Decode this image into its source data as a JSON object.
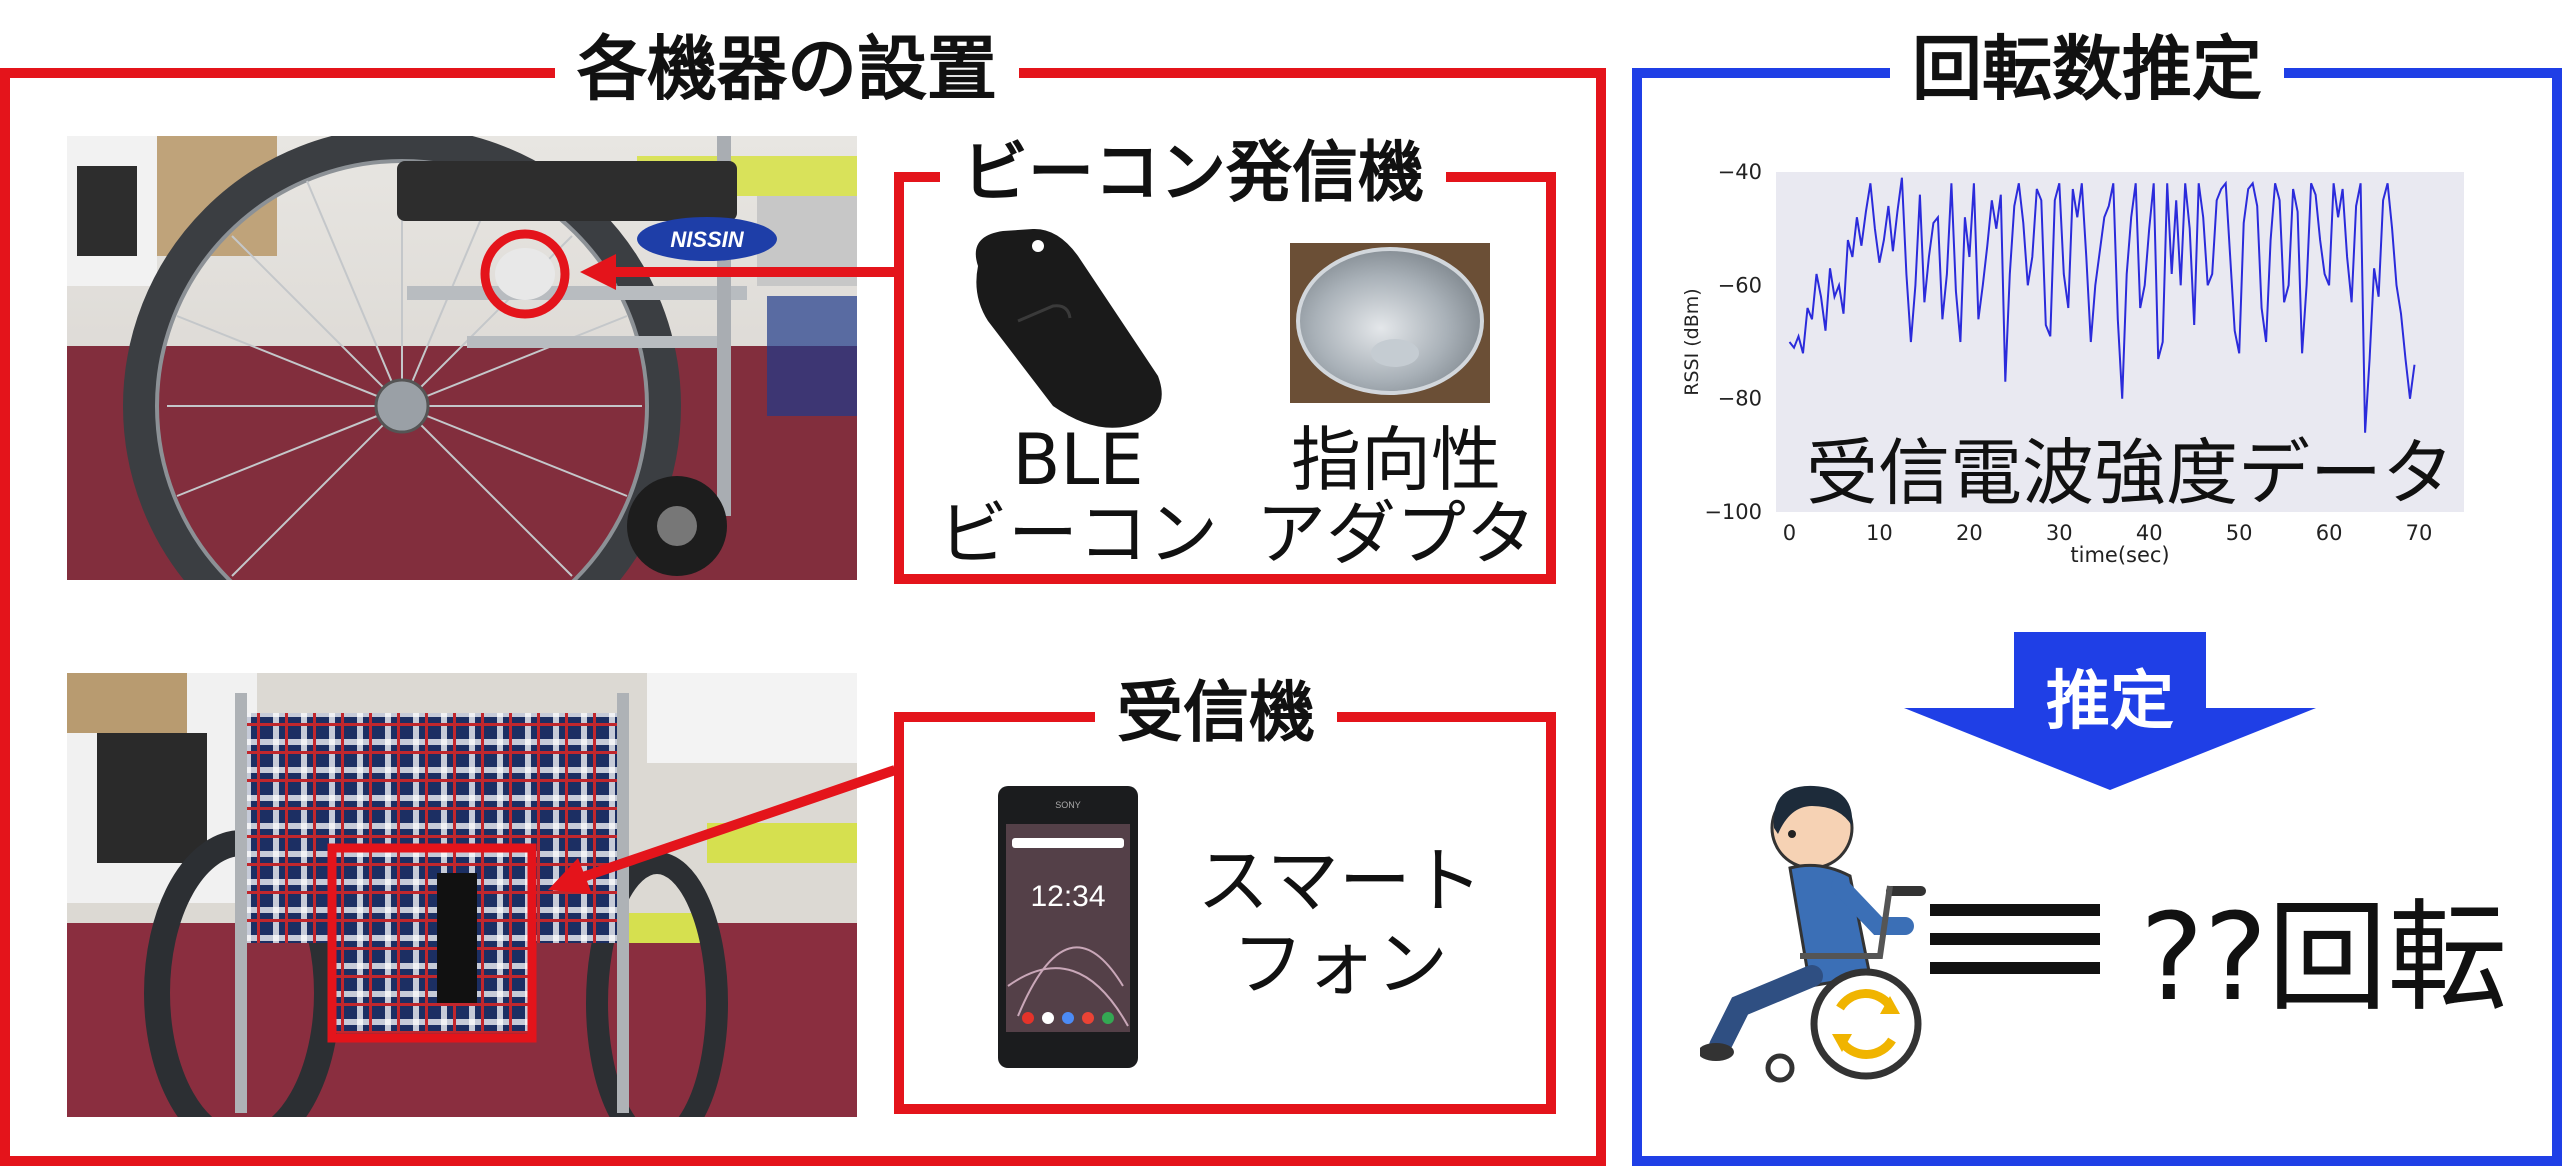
{
  "left_panel": {
    "title": "各機器の設置",
    "beacon_box": {
      "title": "ビーコン発信機",
      "ble_label_line1": "BLE",
      "ble_label_line2": "ビーコン",
      "adapter_label_line1": "指向性",
      "adapter_label_line2": "アダプタ"
    },
    "receiver_box": {
      "title": "受信機",
      "phone_label_line1": "スマート",
      "phone_label_line2": "フォン"
    },
    "wheelchair_brand": "NISSIN"
  },
  "right_panel": {
    "title": "回転数推定",
    "chart_overlay_label": "受信電波強度データ",
    "estimate_label": "推定",
    "result_text": "??回転"
  },
  "chart_data": {
    "type": "line",
    "xlabel": "time(sec)",
    "ylabel": "RSSI (dBm)",
    "xlim": [
      -1.5,
      75
    ],
    "ylim": [
      -100,
      -40
    ],
    "xticks": [
      "0",
      "10",
      "20",
      "30",
      "40",
      "50",
      "60",
      "70"
    ],
    "yticks": [
      "−100",
      "−80",
      "−60",
      "−40"
    ],
    "grid": false,
    "colors": {
      "line": "#2b2bdb",
      "background": "#e9e9f1"
    },
    "series": [
      {
        "values_x": [
          0,
          0.5,
          1,
          1.5,
          2,
          2.5,
          3,
          3.5,
          4,
          4.5,
          5,
          5.5,
          6,
          6.5,
          7,
          7.5,
          8,
          8.5,
          9,
          9.5,
          10,
          10.5,
          11,
          11.5,
          12,
          12.5,
          13,
          13.5,
          14,
          14.5,
          15,
          15.5,
          16,
          16.5,
          17,
          17.5,
          18,
          18.5,
          19,
          19.5,
          20,
          20.5,
          21,
          21.5,
          22,
          22.5,
          23,
          23.5,
          24,
          24.5,
          25,
          25.5,
          26,
          26.5,
          27,
          27.5,
          28,
          28.5,
          29,
          29.5,
          30,
          30.5,
          31,
          31.5,
          32,
          32.5,
          33,
          33.5,
          34,
          34.5,
          35,
          35.5,
          36,
          36.5,
          37,
          37.5,
          38,
          38.5,
          39,
          39.5,
          40,
          40.5,
          41,
          41.5,
          42,
          42.5,
          43,
          43.5,
          44,
          44.5,
          45,
          45.5,
          46,
          46.5,
          47,
          47.5,
          48,
          48.5,
          49,
          49.5,
          50,
          50.5,
          51,
          51.5,
          52,
          52.5,
          53,
          53.5,
          54,
          54.5,
          55,
          55.5,
          56,
          56.5,
          57,
          57.5,
          58,
          58.5,
          59,
          59.5,
          60,
          60.5,
          61,
          61.5,
          62,
          62.5,
          63,
          63.5,
          64,
          64.5,
          65,
          65.5,
          66,
          66.5,
          67,
          67.5,
          68,
          68.5,
          69,
          69.5,
          70,
          70.5,
          71,
          71.5
        ],
        "values_y": [
          -70,
          -71,
          -69,
          -72,
          -64,
          -66,
          -58,
          -62,
          -68,
          -57,
          -62,
          -60,
          -65,
          -52,
          -55,
          -48,
          -53,
          -47,
          -42,
          -50,
          -56,
          -52,
          -46,
          -54,
          -47,
          -41,
          -58,
          -70,
          -60,
          -44,
          -63,
          -55,
          -49,
          -48,
          -66,
          -58,
          -42,
          -61,
          -70,
          -48,
          -55,
          -42,
          -66,
          -60,
          -53,
          -45,
          -50,
          -44,
          -77,
          -58,
          -46,
          -42,
          -49,
          -60,
          -55,
          -43,
          -45,
          -67,
          -69,
          -45,
          -42,
          -58,
          -64,
          -43,
          -48,
          -42,
          -55,
          -70,
          -60,
          -54,
          -48,
          -46,
          -42,
          -66,
          -80,
          -58,
          -48,
          -42,
          -64,
          -60,
          -50,
          -42,
          -73,
          -70,
          -42,
          -58,
          -45,
          -60,
          -42,
          -50,
          -67,
          -42,
          -48,
          -60,
          -58,
          -45,
          -43,
          -42,
          -55,
          -68,
          -72,
          -49,
          -43,
          -42,
          -46,
          -64,
          -70,
          -52,
          -42,
          -45,
          -63,
          -60,
          -43,
          -47,
          -72,
          -60,
          -42,
          -44,
          -52,
          -58,
          -60,
          -42,
          -48,
          -43,
          -55,
          -63,
          -46,
          -42,
          -86,
          -73,
          -57,
          -62,
          -45,
          -42,
          -50,
          -60,
          -65,
          -73,
          -80,
          -74
        ]
      }
    ]
  }
}
